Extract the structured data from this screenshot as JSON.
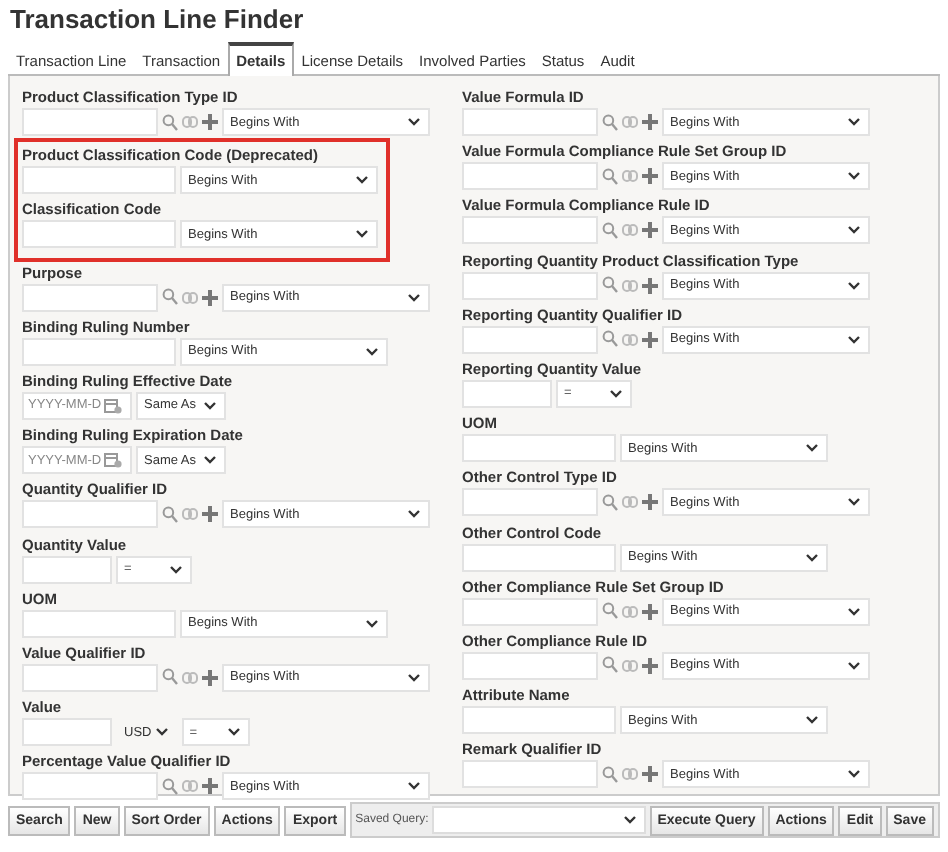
{
  "window": {
    "title": "Transaction Line Finder"
  },
  "tabs": [
    {
      "label": "Transaction Line",
      "selected": false
    },
    {
      "label": "Transaction",
      "selected": false
    },
    {
      "label": "Details",
      "selected": true
    },
    {
      "label": "License Details",
      "selected": false
    },
    {
      "label": "Involved Parties",
      "selected": false
    },
    {
      "label": "Status",
      "selected": false
    },
    {
      "label": "Audit",
      "selected": false
    }
  ],
  "columns": [
    {
      "blocks": [
        {
          "highlighted": false,
          "fields": [
            {
              "label": "Product Classification Type ID",
              "kind": "lookup",
              "operator": "Begins With"
            }
          ]
        },
        {
          "highlighted": true,
          "fields": [
            {
              "label": "Product Classification Code (Deprecated)",
              "kind": "plain",
              "operator": "Begins With"
            },
            {
              "label": "Classification Code",
              "kind": "plain",
              "operator": "Begins With"
            }
          ]
        },
        {
          "highlighted": false,
          "fields": [
            {
              "label": "Purpose",
              "kind": "lookup",
              "operator": "Begins With"
            },
            {
              "label": "Binding Ruling Number",
              "kind": "plain",
              "operator": "Begins With"
            },
            {
              "label": "Binding Ruling Effective Date",
              "kind": "date",
              "placeholder": "YYYY-MM-D",
              "operator": "Same As"
            },
            {
              "label": "Binding Ruling Expiration Date",
              "kind": "date",
              "placeholder": "YYYY-MM-D",
              "operator": "Same As"
            },
            {
              "label": "Quantity Qualifier ID",
              "kind": "lookup",
              "operator": "Begins With"
            },
            {
              "label": "Quantity Value",
              "kind": "number",
              "operator": "="
            },
            {
              "label": "UOM",
              "kind": "plain",
              "operator": "Begins With"
            },
            {
              "label": "Value Qualifier ID",
              "kind": "lookup",
              "operator": "Begins With"
            },
            {
              "label": "Value",
              "kind": "currency",
              "currency": "USD",
              "operator": "="
            },
            {
              "label": "Percentage Value Qualifier ID",
              "kind": "lookup",
              "operator": "Begins With"
            }
          ]
        }
      ]
    },
    {
      "blocks": [
        {
          "highlighted": false,
          "fields": [
            {
              "label": "Value Formula ID",
              "kind": "lookup",
              "operator": "Begins With"
            },
            {
              "label": "Value Formula Compliance Rule Set Group ID",
              "kind": "lookup",
              "operator": "Begins With"
            },
            {
              "label": "Value Formula Compliance Rule ID",
              "kind": "lookup",
              "operator": "Begins With"
            },
            {
              "label": "Reporting Quantity Product Classification Type",
              "kind": "lookup",
              "operator": "Begins With"
            },
            {
              "label": "Reporting Quantity Qualifier ID",
              "kind": "lookup",
              "operator": "Begins With"
            },
            {
              "label": "Reporting Quantity Value",
              "kind": "number",
              "operator": "="
            },
            {
              "label": "UOM",
              "kind": "plain",
              "operator": "Begins With"
            },
            {
              "label": "Other Control Type ID",
              "kind": "lookup",
              "operator": "Begins With"
            },
            {
              "label": "Other Control Code",
              "kind": "plain",
              "operator": "Begins With"
            },
            {
              "label": "Other Compliance Rule Set Group ID",
              "kind": "lookup",
              "operator": "Begins With"
            },
            {
              "label": "Other Compliance Rule ID",
              "kind": "lookup",
              "operator": "Begins With"
            },
            {
              "label": "Attribute Name",
              "kind": "plain",
              "operator": "Begins With"
            },
            {
              "label": "Remark Qualifier ID",
              "kind": "lookup",
              "operator": "Begins With"
            }
          ]
        }
      ]
    }
  ],
  "toolbar": {
    "left_buttons": [
      "Search",
      "New",
      "Sort Order",
      "Actions",
      "Export"
    ],
    "saved_query_label": "Saved Query:",
    "right_buttons": [
      "Execute Query",
      "Actions",
      "Edit",
      "Save"
    ]
  }
}
